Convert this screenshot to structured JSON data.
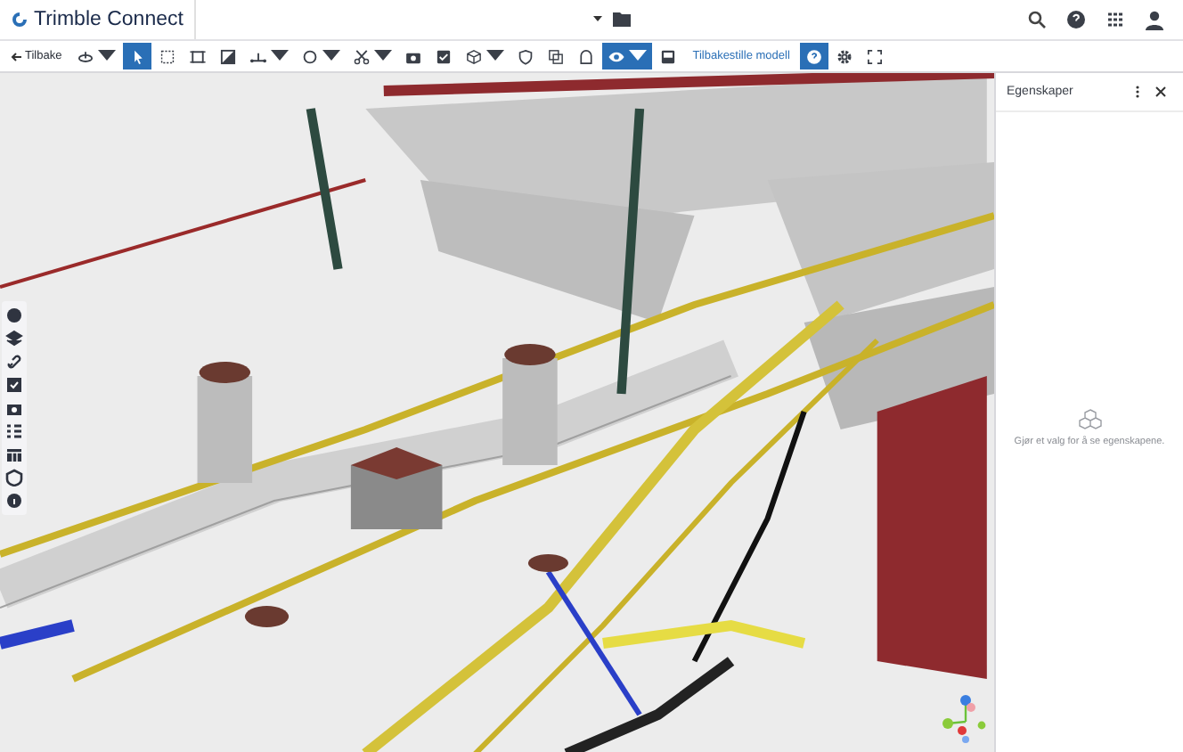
{
  "header": {
    "brand": "Trimble Connect"
  },
  "toolbar": {
    "back": "Tilbake",
    "tools": [
      {
        "kind": "dropdown",
        "selected": false
      },
      {
        "kind": "button",
        "selected": true
      },
      {
        "kind": "button",
        "selected": false
      },
      {
        "kind": "button",
        "selected": false
      },
      {
        "kind": "button",
        "selected": false
      },
      {
        "kind": "dropdown",
        "selected": false
      },
      {
        "kind": "dropdown",
        "selected": false
      },
      {
        "kind": "dropdown",
        "selected": false
      },
      {
        "kind": "button",
        "selected": false
      },
      {
        "kind": "button",
        "selected": false
      },
      {
        "kind": "dropdown",
        "selected": false
      },
      {
        "kind": "button",
        "selected": false
      },
      {
        "kind": "button",
        "selected": false
      },
      {
        "kind": "button",
        "selected": false
      },
      {
        "kind": "dropdown",
        "selected": true
      },
      {
        "kind": "button",
        "selected": false
      }
    ],
    "reset": "Tilbakestille modell",
    "tools_right": [
      {
        "selected": true
      },
      {
        "selected": false
      },
      {
        "selected": false
      }
    ]
  },
  "panel": {
    "title": "Egenskaper",
    "empty_message": "Gjør et valg for å se egenskapene."
  }
}
